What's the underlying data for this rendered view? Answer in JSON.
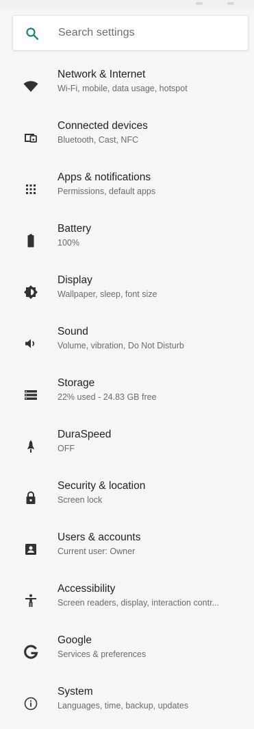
{
  "search": {
    "placeholder": "Search settings",
    "icon": "search-icon",
    "accent_color": "#15857e"
  },
  "icon_color": "#323232",
  "settings": [
    {
      "icon": "wifi-icon",
      "title": "Network & Internet",
      "subtitle": "Wi-Fi, mobile, data usage, hotspot"
    },
    {
      "icon": "connected-devices-icon",
      "title": "Connected devices",
      "subtitle": "Bluetooth, Cast, NFC"
    },
    {
      "icon": "apps-grid-icon",
      "title": "Apps & notifications",
      "subtitle": "Permissions, default apps"
    },
    {
      "icon": "battery-icon",
      "title": "Battery",
      "subtitle": "100%"
    },
    {
      "icon": "brightness-icon",
      "title": "Display",
      "subtitle": "Wallpaper, sleep, font size"
    },
    {
      "icon": "volume-icon",
      "title": "Sound",
      "subtitle": "Volume, vibration, Do Not Disturb"
    },
    {
      "icon": "storage-icon",
      "title": "Storage",
      "subtitle": "22% used - 24.83 GB free"
    },
    {
      "icon": "rocket-icon",
      "title": "DuraSpeed",
      "subtitle": "OFF"
    },
    {
      "icon": "lock-icon",
      "title": "Security & location",
      "subtitle": "Screen lock"
    },
    {
      "icon": "account-box-icon",
      "title": "Users & accounts",
      "subtitle": "Current user: Owner"
    },
    {
      "icon": "accessibility-icon",
      "title": "Accessibility",
      "subtitle": "Screen readers, display, interaction contr..."
    },
    {
      "icon": "google-icon",
      "title": "Google",
      "subtitle": "Services & preferences"
    },
    {
      "icon": "info-icon",
      "title": "System",
      "subtitle": "Languages, time, backup, updates"
    }
  ]
}
